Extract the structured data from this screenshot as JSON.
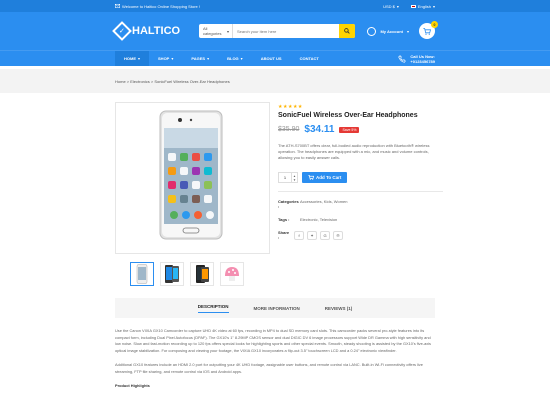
{
  "topbar": {
    "welcome": "Welcome to Haltico Online Shopping Store !",
    "currency": "USD $",
    "language": "English"
  },
  "header": {
    "logo": "HALTICO",
    "search_category": "All categories",
    "search_placeholder": "Search your item here",
    "account_label": "My Account",
    "cart_count": "0"
  },
  "nav": {
    "items": [
      {
        "label": "HOME"
      },
      {
        "label": "SHOP"
      },
      {
        "label": "PAGES"
      },
      {
        "label": "BLOG"
      },
      {
        "label": "ABOUT US"
      },
      {
        "label": "CONTACT"
      }
    ],
    "call_label": "Call Us Now:",
    "call_number": "+0123456789"
  },
  "breadcrumb": "Home > Electronics > SonicFuel Wireless Over-Ear Headphones",
  "product": {
    "stars": "★★★★★",
    "title": "SonicFuel Wireless Over-Ear Headphones",
    "old_price": "$35.90",
    "new_price": "$34.11",
    "save": "Save 5%",
    "description": "The ATH-S700BT offers clear, full-bodied audio reproduction with Bluetooth® wireless operation. The headphones are equipped with a mic, and music and volume controls, allowing you to easily answer calls.",
    "qty": "1",
    "add_label": "Add To Cart",
    "categories_label": "Categories :",
    "categories_value": "Accessories, Kids, Women",
    "tags_label": "Tags :",
    "tags_value": "Electronic, Television",
    "share_label": "Share :"
  },
  "tabs": [
    {
      "label": "DESCRIPTION"
    },
    {
      "label": "MORE INFORMATION"
    },
    {
      "label": "REVIEWS (1)"
    }
  ],
  "body": {
    "p1": "Use the Canon VIXIA GX10 Camcorder to capture UHD 4K video at 60 fps, recording in MP4 to dual SD memory card slots. This camcorder packs several pro-style features into its compact form, including Dual Pixel Autofocus (DPAF). The GX10's 1\" 8.29MP CMOS sensor and dual DIGIC DV 6 image processors support Wide DR Gamma with high sensitivity and low noise. Slow and fast-motion recording up to 120 fps offers special looks for highlighting sports and other special events. Smooth, steady shooting is assisted by the GX10's five-axis optical image stabilization. For composing and viewing your footage, the VIXIA GX10 incorporates a flip-out 3.5\" touchscreen LCD and a 0.24\" electronic viewfinder.",
    "p2": "Additional GX10 features include an HDMI 2.0 port for outputting your 4K UHD footage, assignable user buttons, and remote control via LANC. Built-in Wi-Fi connectivity offers live streaming, FTP file sharing, and remote control via iOS and Android apps.",
    "highlights": "Product Highlights"
  },
  "colors": {
    "primary": "#2b8ef0",
    "topbar": "#1f7fdc",
    "accent": "#ffd400",
    "sale": "#e53935"
  }
}
